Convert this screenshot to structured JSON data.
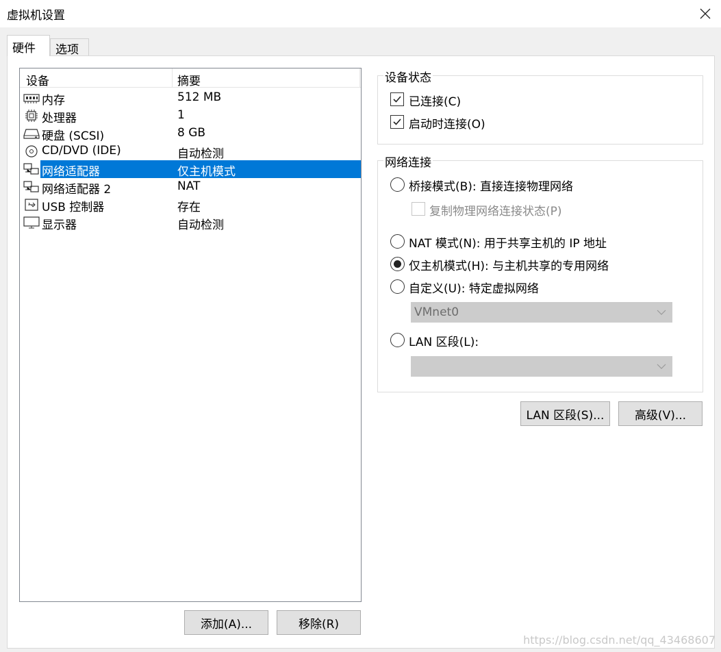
{
  "window": {
    "title": "虚拟机设置"
  },
  "tabs": [
    {
      "label": "硬件"
    },
    {
      "label": "选项"
    }
  ],
  "device_list": {
    "columns": [
      "设备",
      "摘要"
    ],
    "rows": [
      {
        "name": "内存",
        "summary": "512 MB",
        "icon": "memory-icon"
      },
      {
        "name": "处理器",
        "summary": "1",
        "icon": "cpu-icon"
      },
      {
        "name": "硬盘 (SCSI)",
        "summary": "8 GB",
        "icon": "harddisk-icon"
      },
      {
        "name": "CD/DVD (IDE)",
        "summary": "自动检测",
        "icon": "cd-dvd-icon"
      },
      {
        "name": "网络适配器",
        "summary": "仅主机模式",
        "icon": "network-adapter-icon",
        "selected": true
      },
      {
        "name": "网络适配器 2",
        "summary": "NAT",
        "icon": "network-adapter-icon"
      },
      {
        "name": "USB 控制器",
        "summary": "存在",
        "icon": "usb-icon"
      },
      {
        "name": "显示器",
        "summary": "自动检测",
        "icon": "monitor-icon"
      }
    ]
  },
  "buttons": {
    "add": "添加(A)...",
    "remove": "移除(R)",
    "lan_segments": "LAN 区段(S)...",
    "advanced": "高级(V)..."
  },
  "device_status": {
    "title": "设备状态",
    "connected": {
      "label": "已连接(C)",
      "checked": true
    },
    "connect_at_power_on": {
      "label": "启动时连接(O)",
      "checked": true
    }
  },
  "network_connection": {
    "title": "网络连接",
    "bridged": {
      "label": "桥接模式(B): 直接连接物理网络",
      "selected": false
    },
    "replicate": {
      "label": "复制物理网络连接状态(P)",
      "checked": false,
      "disabled": true
    },
    "nat": {
      "label": "NAT 模式(N): 用于共享主机的 IP 地址",
      "selected": false
    },
    "host_only": {
      "label": "仅主机模式(H): 与主机共享的专用网络",
      "selected": true
    },
    "custom": {
      "label": "自定义(U): 特定虚拟网络",
      "selected": false
    },
    "custom_value": "VMnet0",
    "lan_segment": {
      "label": "LAN 区段(L):",
      "selected": false
    },
    "lan_segment_value": ""
  },
  "watermark": "https://blog.csdn.net/qq_43468607",
  "colors": {
    "selection": "#0078d7",
    "background": "#f0f0f0"
  }
}
